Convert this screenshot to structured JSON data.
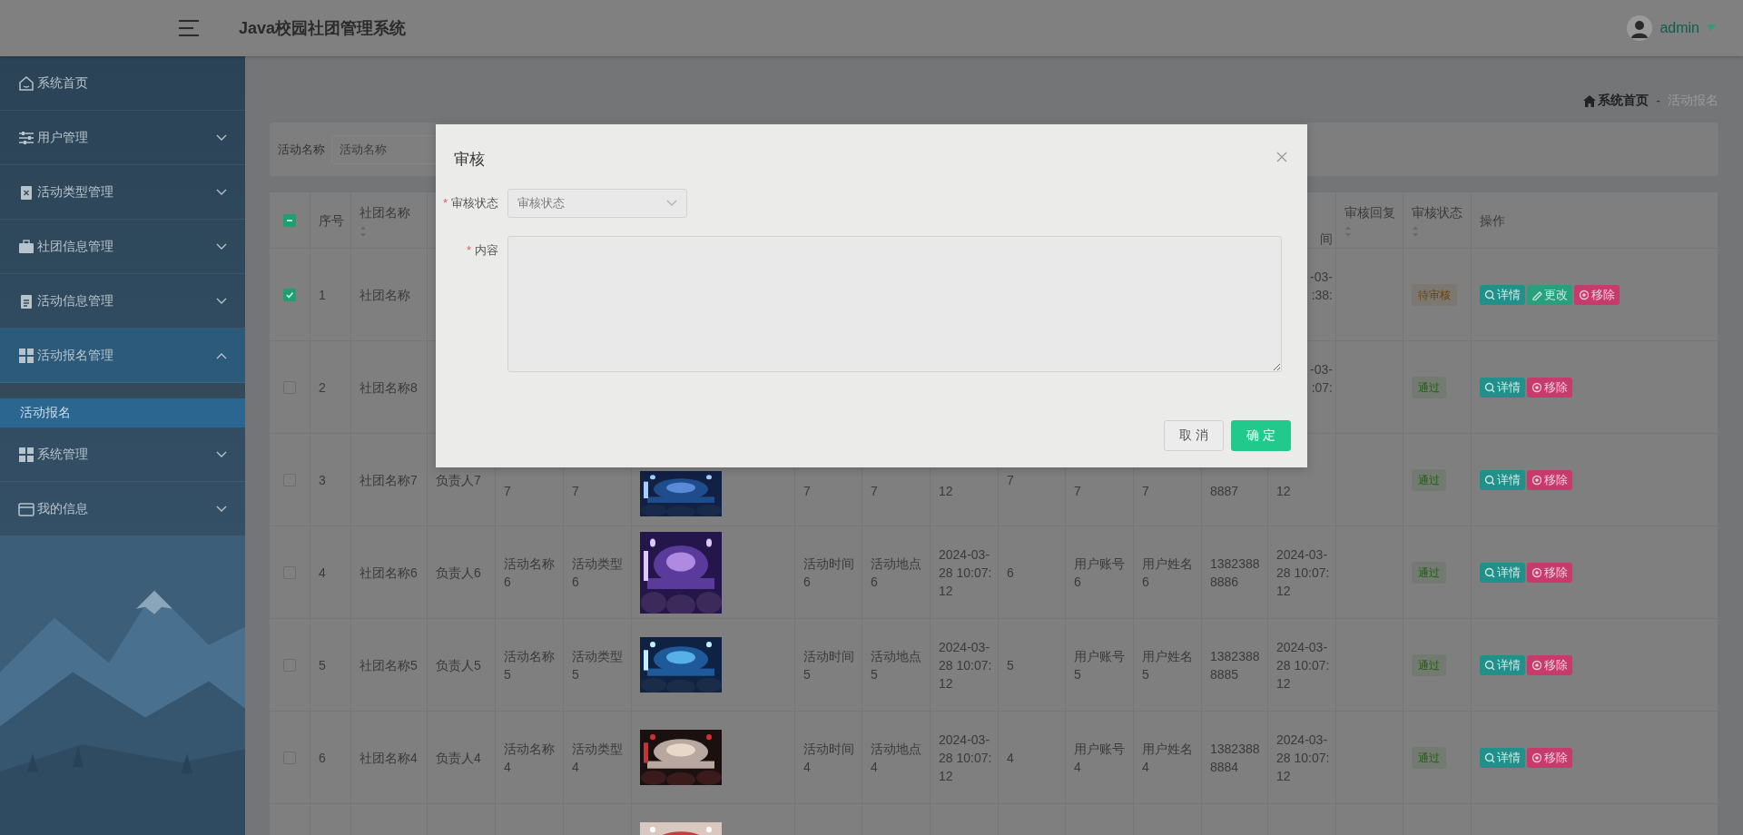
{
  "header": {
    "title": "Java校园社团管理系统",
    "user": "admin"
  },
  "sidebar": {
    "items": [
      {
        "label": "系统首页"
      },
      {
        "label": "用户管理",
        "expanded": false
      },
      {
        "label": "活动类型管理",
        "expanded": false
      },
      {
        "label": "社团信息管理",
        "expanded": false
      },
      {
        "label": "活动信息管理",
        "expanded": false
      },
      {
        "label": "活动报名管理",
        "expanded": true,
        "children": [
          {
            "label": "活动报名",
            "selected": true
          }
        ]
      },
      {
        "label": "系统管理",
        "expanded": false
      },
      {
        "label": "我的信息",
        "expanded": false
      }
    ]
  },
  "breadcrumb": {
    "items": [
      "系统首页",
      "活动报名"
    ],
    "separator": "-"
  },
  "search": {
    "label": "活动名称",
    "placeholder": "活动名称"
  },
  "table": {
    "select_all": {
      "indeterminate": true
    },
    "header": {
      "index": {
        "label": "序号"
      },
      "club": {
        "label": "社团名称",
        "sortable": true
      },
      "apply_time": {
        "label": "间",
        "clipped_left": true
      },
      "reply": {
        "label": "审核回复",
        "sortable": true
      },
      "status": {
        "label": "审核状态",
        "sortable": true
      },
      "actions": {
        "label": "操作"
      }
    },
    "rows": [
      {
        "selected": true,
        "index": "1",
        "club": "社团名称",
        "apply_time": {
          "lines": [
            "-03-",
            ":38:"
          ],
          "clipped_left": true
        },
        "status": {
          "label": "待审核",
          "color": "#6e4206"
        },
        "actions": [
          {
            "label": "详情",
            "kind": "detail"
          },
          {
            "label": "更改",
            "kind": "edit"
          },
          {
            "label": "移除",
            "kind": "remove"
          }
        ]
      },
      {
        "selected": false,
        "index": "2",
        "club": "社团名称8",
        "apply_time": {
          "lines": [
            "-03-",
            ":07:"
          ],
          "clipped_left": true
        },
        "status": {
          "label": "通过",
          "color": "#1f5c10"
        },
        "actions": [
          {
            "label": "详情",
            "kind": "detail"
          },
          {
            "label": "移除",
            "kind": "remove"
          }
        ]
      },
      {
        "selected": false,
        "index": "3",
        "club": "社团名称7",
        "leader": "负责人7",
        "activity_name": {
          "lines": [
            "7"
          ],
          "clipped_top": true
        },
        "activity_type": {
          "lines": [
            "7"
          ],
          "clipped_top": true
        },
        "image": {
          "kind": "picture",
          "clipped_top": true
        },
        "activity_time": {
          "lines": [
            "7"
          ],
          "clipped_top": true
        },
        "activity_place": {
          "lines": [
            "7"
          ],
          "clipped_top": true
        },
        "created": {
          "lines": [
            "12"
          ],
          "clipped_top": true
        },
        "count": "7",
        "account": {
          "lines": [
            "7"
          ],
          "clipped_top": true
        },
        "user_name": {
          "lines": [
            "7"
          ],
          "clipped_top": true
        },
        "phone": {
          "lines": [
            "8887"
          ],
          "clipped_top": true
        },
        "apply_time": {
          "lines": [
            "12"
          ],
          "clipped_top": true
        },
        "status": {
          "label": "通过",
          "color": "#1f5c10"
        },
        "actions": [
          {
            "label": "详情",
            "kind": "detail"
          },
          {
            "label": "移除",
            "kind": "remove"
          }
        ]
      },
      {
        "selected": false,
        "index": "4",
        "club": "社团名称6",
        "leader": "负责人6",
        "activity_name": "活动名称6",
        "activity_type": "活动类型6",
        "image": {
          "kind": "picture"
        },
        "activity_time": "活动时间6",
        "activity_place": "活动地点6",
        "created": "2024-03-28 10:07:12",
        "count": "6",
        "account": "用户账号6",
        "user_name": "用户姓名6",
        "phone": "13823888886",
        "apply_time": "2024-03-28 10:07:12",
        "status": {
          "label": "通过",
          "color": "#1f5c10"
        },
        "actions": [
          {
            "label": "详情",
            "kind": "detail"
          },
          {
            "label": "移除",
            "kind": "remove"
          }
        ]
      },
      {
        "selected": false,
        "index": "5",
        "club": "社团名称5",
        "leader": "负责人5",
        "activity_name": "活动名称5",
        "activity_type": "活动类型5",
        "image": {
          "kind": "picture"
        },
        "activity_time": "活动时间5",
        "activity_place": "活动地点5",
        "created": "2024-03-28 10:07:12",
        "count": "5",
        "account": "用户账号5",
        "user_name": "用户姓名5",
        "phone": "13823888885",
        "apply_time": "2024-03-28 10:07:12",
        "status": {
          "label": "通过",
          "color": "#1f5c10"
        },
        "actions": [
          {
            "label": "详情",
            "kind": "detail"
          },
          {
            "label": "移除",
            "kind": "remove"
          }
        ]
      },
      {
        "selected": false,
        "index": "6",
        "club": "社团名称4",
        "leader": "负责人4",
        "activity_name": "活动名称4",
        "activity_type": "活动类型4",
        "image": {
          "kind": "picture"
        },
        "activity_time": "活动时间4",
        "activity_place": "活动地点4",
        "created": "2024-03-28 10:07:12",
        "count": "4",
        "account": "用户账号4",
        "user_name": "用户姓名4",
        "phone": "13823888884",
        "apply_time": "2024-03-28 10:07:12",
        "status": {
          "label": "通过",
          "color": "#1f5c10"
        },
        "actions": [
          {
            "label": "详情",
            "kind": "detail"
          },
          {
            "label": "移除",
            "kind": "remove"
          }
        ]
      },
      {
        "image": {
          "kind": "picture"
        }
      }
    ]
  },
  "dialog": {
    "title": "审核",
    "fields": [
      {
        "kind": "select",
        "required_mark": "*",
        "label": "审核状态",
        "placeholder": "审核状态"
      },
      {
        "kind": "textarea",
        "required_mark": "*",
        "label": "内容"
      }
    ],
    "buttons": [
      {
        "label": "取消",
        "kind": "secondary"
      },
      {
        "label": "确定",
        "kind": "primary"
      }
    ]
  }
}
